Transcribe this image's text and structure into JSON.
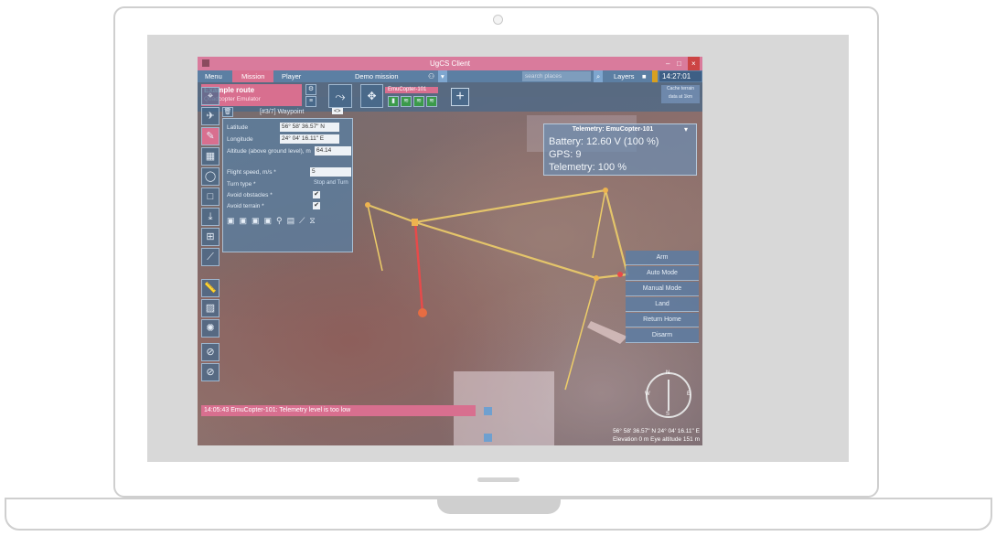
{
  "window": {
    "title": "UgCS Client",
    "controls": [
      "–",
      "□",
      "×"
    ]
  },
  "menubar": {
    "menu": "Menu",
    "tabs": [
      "Mission",
      "Player"
    ],
    "mission_name": "Demo mission",
    "search_placeholder": "search places",
    "layers": "Layers",
    "clock": "14:27:01"
  },
  "route": {
    "name": "Example route",
    "vehicle_profile": "Quadcopter Emulator"
  },
  "vehicle": {
    "name": "EmuCopter-101"
  },
  "cache": {
    "line1": "Cache terrain",
    "line2": "data at 1km"
  },
  "waypoint_panel": {
    "header": "[#3/7] Waypoint",
    "fields": [
      {
        "label": "Latitude",
        "value": "56° 58' 36.57\" N"
      },
      {
        "label": "Longitude",
        "value": "24° 04' 16.11\" E"
      },
      {
        "label": "Altitude (above ground level), m",
        "value": "64.14"
      },
      {
        "label": "Flight speed, m/s *",
        "value": "5"
      },
      {
        "label": "Turn type *",
        "value": "Stop and Turn"
      },
      {
        "label": "Avoid obstacles *",
        "value": "✔"
      },
      {
        "label": "Avoid terrain *",
        "value": "✔"
      }
    ]
  },
  "telemetry": {
    "title": "Telemetry: EmuCopter-101",
    "lines": [
      "Battery: 12.60 V (100 %)",
      "GPS: 9",
      "Telemetry: 100 %"
    ]
  },
  "commands": [
    "Arm",
    "Auto Mode",
    "Manual Mode",
    "Land",
    "Return Home",
    "Disarm"
  ],
  "alert": "14:05:43 EmuCopter-101: Telemetry level is too low",
  "status": {
    "coords": "56° 58' 36.57\" N   24° 04' 16.11\" E",
    "elevation": "Elevation 0 m    Eye altitude 151 m"
  },
  "compass_labels": [
    "N",
    "E",
    "S",
    "W"
  ],
  "colors": {
    "accent": "#d86f8f",
    "panel": "#5c7fa3",
    "route": "#f0e060",
    "segment": "#e8403a"
  }
}
